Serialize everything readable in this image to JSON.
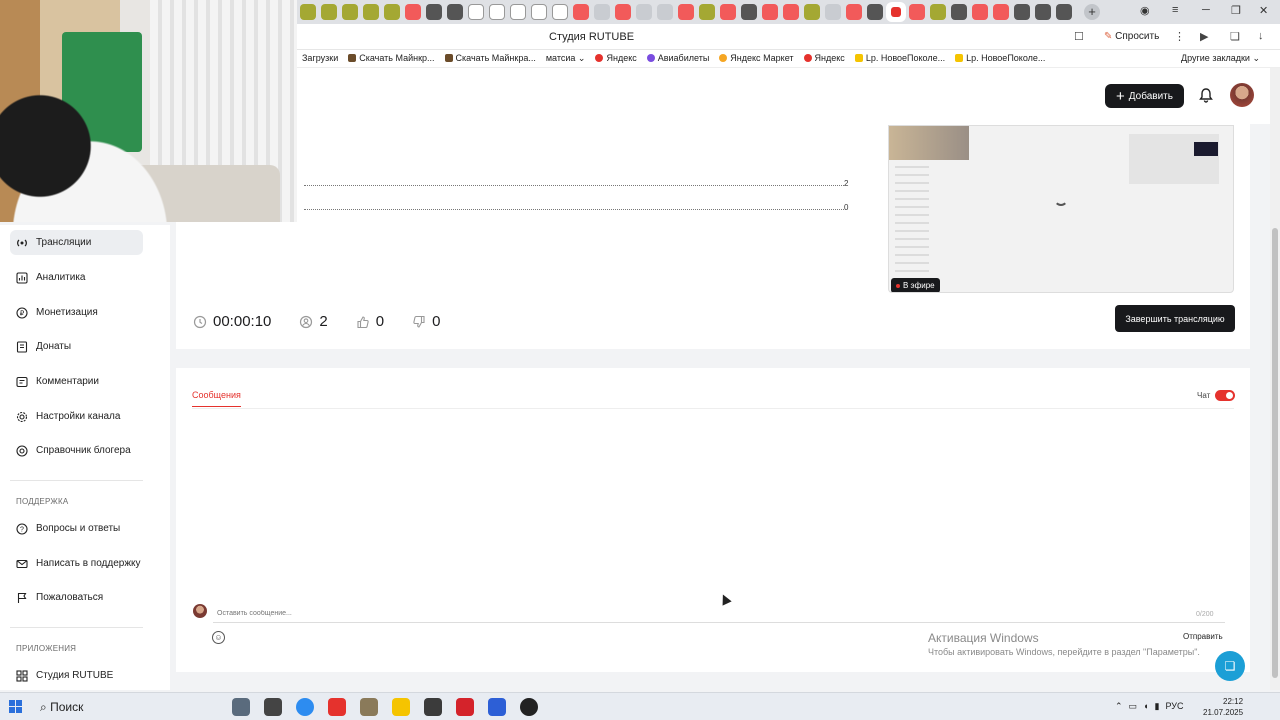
{
  "browser": {
    "tab_title": "Студия RUTUBE",
    "ask_label": "Спросить",
    "bookmarks": [
      "Загрузки",
      "Скачать Майнкр...",
      "Скачать Майнкра...",
      "матсиа",
      "Яндекс",
      "Авиабилеты",
      "Яндекс Маркет",
      "Яндекс",
      "Lp. НовоеПоколе...",
      "Lp. НовоеПоколе..."
    ],
    "other_bookmarks": "Другие закладки"
  },
  "header": {
    "add_button": "Добавить"
  },
  "sidebar": {
    "items": [
      {
        "label": "Трансляции",
        "icon": "broadcast-icon",
        "active": true
      },
      {
        "label": "Аналитика",
        "icon": "analytics-icon"
      },
      {
        "label": "Монетизация",
        "icon": "monetization-icon"
      },
      {
        "label": "Донаты",
        "icon": "donate-icon"
      },
      {
        "label": "Комментарии",
        "icon": "comment-icon"
      },
      {
        "label": "Настройки канала",
        "icon": "settings-icon"
      },
      {
        "label": "Справочник блогера",
        "icon": "handbook-icon"
      }
    ],
    "support_title": "ПОДДЕРЖКА",
    "support_items": [
      {
        "label": "Вопросы и ответы",
        "icon": "faq-icon"
      },
      {
        "label": "Написать в поддержку",
        "icon": "mail-icon"
      },
      {
        "label": "Пожаловаться",
        "icon": "flag-icon"
      }
    ],
    "apps_title": "ПРИЛОЖЕНИЯ",
    "apps_items": [
      {
        "label": "Студия RUTUBE",
        "icon": "grid-icon"
      }
    ]
  },
  "stream": {
    "graph_top_value": "2",
    "graph_bottom_value": "0",
    "live_badge": "В эфире",
    "duration": "00:00:10",
    "viewers": "2",
    "likes": "0",
    "dislikes": "0",
    "end_button": "Завершить трансляцию"
  },
  "chat": {
    "tab_label": "Сообщения",
    "toggle_label": "Чат",
    "toggle_on": true,
    "input_placeholder": "Оставить сообщение...",
    "char_count": "0/200",
    "send_label": "Отправить"
  },
  "windows_notice": {
    "title": "Активация Windows",
    "subtitle": "Чтобы активировать Windows, перейдите в раздел \"Параметры\"."
  },
  "taskbar": {
    "search_label": "Поиск",
    "lang": "РУС",
    "time": "22:12",
    "date": "21.07.2025"
  },
  "colors": {
    "accent_red": "#e5322d",
    "dark_button": "#18191c",
    "help_blue": "#1c9fd6"
  }
}
